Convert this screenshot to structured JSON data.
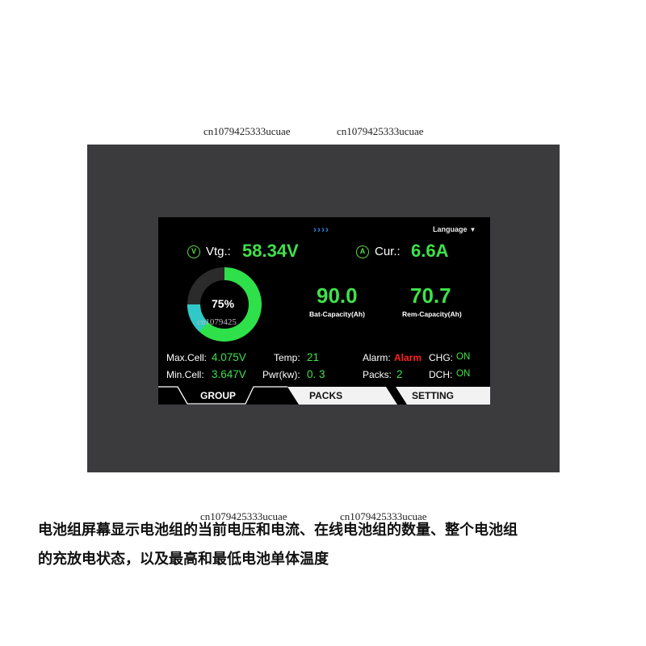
{
  "watermarks": {
    "top_left": "cn1079425333ucuae",
    "top_right": "cn1079425333ucuae",
    "bottom_left": "cn1079425333ucuae",
    "bottom_right": "cn1079425333ucuae",
    "overlay": "cn1079425"
  },
  "screen": {
    "header": {
      "arrows": "››››",
      "language_label": "Language",
      "language_caret": "▼"
    },
    "voltage": {
      "icon_letter": "V",
      "label": "Vtg.:",
      "value": "58.34V"
    },
    "current": {
      "icon_letter": "A",
      "label": "Cur.:",
      "value": "6.6A"
    },
    "soc_ring": {
      "percent_label": "75%",
      "percent": 75,
      "colors": {
        "fill": "#2ee04a",
        "low": "#30c8c8",
        "track": "#2b2b2b"
      }
    },
    "bat_capacity": {
      "value": "90.0",
      "label": "Bat-Capacity(Ah)"
    },
    "rem_capacity": {
      "value": "70.7",
      "label": "Rem-Capacity(Ah)"
    },
    "stats": {
      "max_cell_label": "Max.Cell:",
      "max_cell_value": "4.075V",
      "min_cell_label": "Min.Cell:",
      "min_cell_value": "3.647V",
      "temp_label": "Temp:",
      "temp_value": "21",
      "pwr_label": "Pwr(kw):",
      "pwr_value": "0. 3",
      "alarm_label": "Alarm:",
      "alarm_value": "Alarm",
      "packs_label": "Packs:",
      "packs_value": "2",
      "chg_label": "CHG:",
      "chg_value": "ON",
      "dch_label": "DCH:",
      "dch_value": "ON"
    },
    "tabs": [
      {
        "label": "GROUP",
        "active": true
      },
      {
        "label": "PACKS",
        "active": false
      },
      {
        "label": "SETTING",
        "active": false
      }
    ]
  },
  "caption": {
    "line1": "电池组屏幕显示电池组的当前电压和电流、在线电池组的数量、整个电池组",
    "line2": "的充放电状态，以及最高和最低电池单体温度"
  },
  "colors": {
    "value_green": "#3fe14a",
    "alarm_red": "#ff2020",
    "bezel": "#3b3b3d"
  }
}
